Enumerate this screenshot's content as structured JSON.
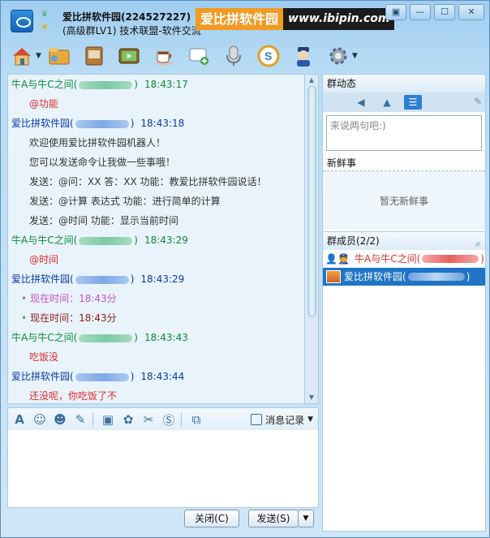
{
  "window": {
    "title": "爱比拼软件园(224527227)",
    "subtitle": "(高级群LV1) 技术联盟-软件交流",
    "ad_cn": "爱比拼软件园",
    "ad_url": "www.ibipin.com",
    "controls": {
      "menu": "▣",
      "minimize": "—",
      "maximize": "☐",
      "close": "✕"
    }
  },
  "toolbar": {
    "icons": [
      "home-icon",
      "folder-share-icon",
      "album-icon",
      "video-icon",
      "coffee-icon",
      "chat-add-icon",
      "mic-icon",
      "soso-icon",
      "police-icon",
      "gear-icon"
    ]
  },
  "chat": {
    "messages": [
      {
        "sender": "牛A与牛C之间(",
        "close": ")",
        "time": "18:43:17",
        "color": "green",
        "lines": [
          {
            "text": "@功能",
            "style": "red"
          }
        ]
      },
      {
        "sender": "爱比拼软件园(",
        "close": ")",
        "time": "18:43:18",
        "color": "blue",
        "lines": [
          {
            "text": "欢迎使用爱比拼软件园机器人！",
            "style": "purple"
          },
          {
            "text": "您可以发送命令让我做一些事哦！",
            "style": "purple"
          },
          {
            "text": "发送：@问：XX 答：XX 功能：教爱比拼软件园说话！",
            "style": "purple"
          },
          {
            "text": "发送：@计算 表达式 功能：进行简单的计算",
            "style": "purple"
          },
          {
            "text": "发送：@时间 功能：显示当前时间",
            "style": "purple"
          }
        ]
      },
      {
        "sender": "牛A与牛C之间(",
        "close": ")",
        "time": "18:43:29",
        "color": "green",
        "lines": [
          {
            "text": "@时间",
            "style": "red"
          }
        ]
      },
      {
        "sender": "爱比拼软件园(",
        "close": ")",
        "time": "18:43:29",
        "color": "blue",
        "lines": [
          {
            "text": "现在时间：18:43分",
            "style": "violet",
            "bullet": "•"
          },
          {
            "text": "现在时间：18:43分",
            "style": "maroon",
            "bullet": "•"
          }
        ]
      },
      {
        "sender": "牛A与牛C之间(",
        "close": ")",
        "time": "18:43:43",
        "color": "green",
        "lines": [
          {
            "text": "吃饭没",
            "style": "red"
          }
        ]
      },
      {
        "sender": "爱比拼软件园(",
        "close": ")",
        "time": "18:43:44",
        "color": "blue",
        "lines": [
          {
            "text": "还没呢，你吃饭了不",
            "style": "red"
          }
        ]
      }
    ]
  },
  "input_toolbar": {
    "tools": [
      "font-icon",
      "emoji-icon",
      "magic-face-icon",
      "edit-icon",
      "image-icon",
      "gift-icon",
      "scissors-icon",
      "sogou-icon",
      "screen-icon"
    ],
    "history_label": "消息记录"
  },
  "buttons": {
    "close": "关闭(C)",
    "send": "发送(S)",
    "drop": "▼"
  },
  "right_panel": {
    "dynamics_title": "群动态",
    "status_placeholder": "来说两句吧:)",
    "fresh_title": "新鲜事",
    "fresh_empty": "暂无新鲜事",
    "members_title": "群成员(2/2)",
    "members": [
      {
        "name": "牛A与牛C之间(",
        "close": ")",
        "selected": false
      },
      {
        "name": "爱比拼软件园(",
        "close": ")",
        "selected": true
      }
    ]
  }
}
